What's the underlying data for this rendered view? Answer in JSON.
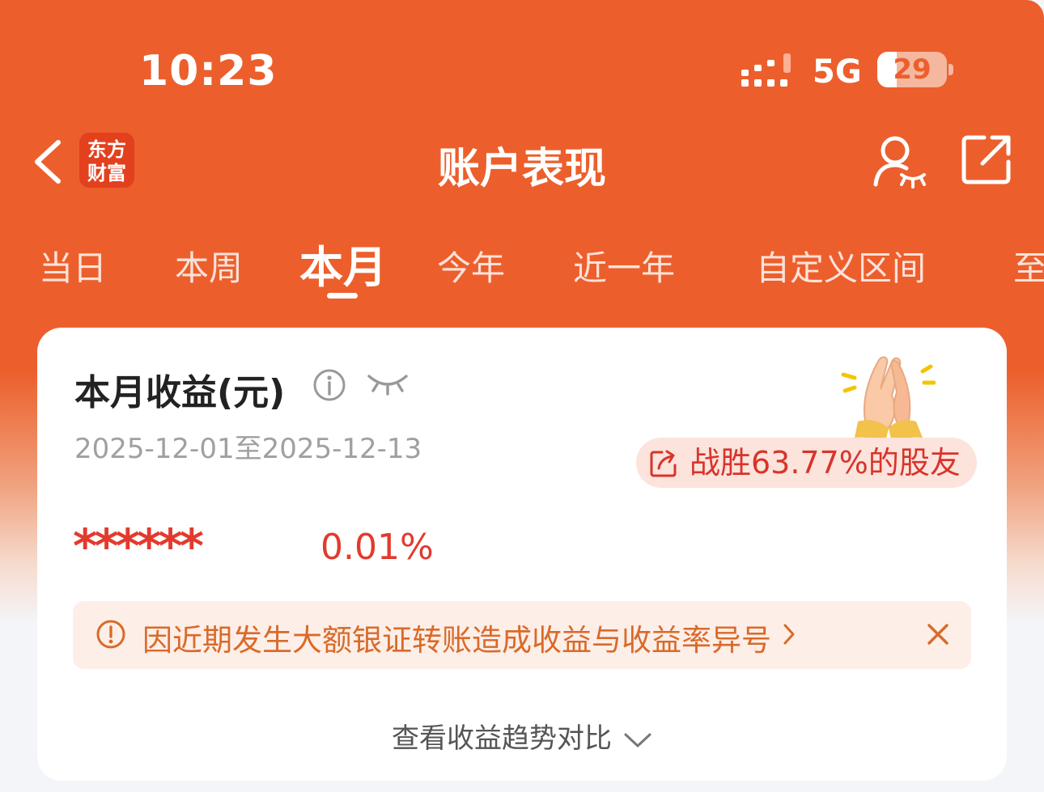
{
  "status_bar": {
    "time": "10:23",
    "network": "5G",
    "battery": "29",
    "battery_level": 0.29
  },
  "nav": {
    "logo_line1": "东方",
    "logo_line2": "财富",
    "title": "账户表现"
  },
  "tabs": [
    {
      "label": "当日",
      "active": false
    },
    {
      "label": "本周",
      "active": false
    },
    {
      "label": "本月",
      "active": true
    },
    {
      "label": "今年",
      "active": false
    },
    {
      "label": "近一年",
      "active": false
    },
    {
      "label": "自定义区间",
      "active": false
    },
    {
      "label": "至",
      "active": false
    }
  ],
  "card": {
    "title": "本月收益(元)",
    "date_range": "2025-12-01至2025-12-13",
    "beat_text": "战胜63.77%的股友",
    "masked_amount": "******",
    "return_pct": "0.01%",
    "notice_text": "因近期发生大额银证转账造成收益与收益率异号",
    "trend_link": "查看收益趋势对比"
  },
  "colors": {
    "brand": "#ec5f2c",
    "accent_red": "#e33a2e",
    "notice_bg": "#fdeee7",
    "notice_text": "#d96a2a"
  },
  "icons": [
    "back-arrow-icon",
    "user-eye-icon",
    "share-icon",
    "info-icon",
    "eye-closed-icon",
    "clapping-hands-icon",
    "share-out-icon",
    "warning-icon",
    "chevron-right-icon",
    "close-icon",
    "chevron-down-icon"
  ]
}
